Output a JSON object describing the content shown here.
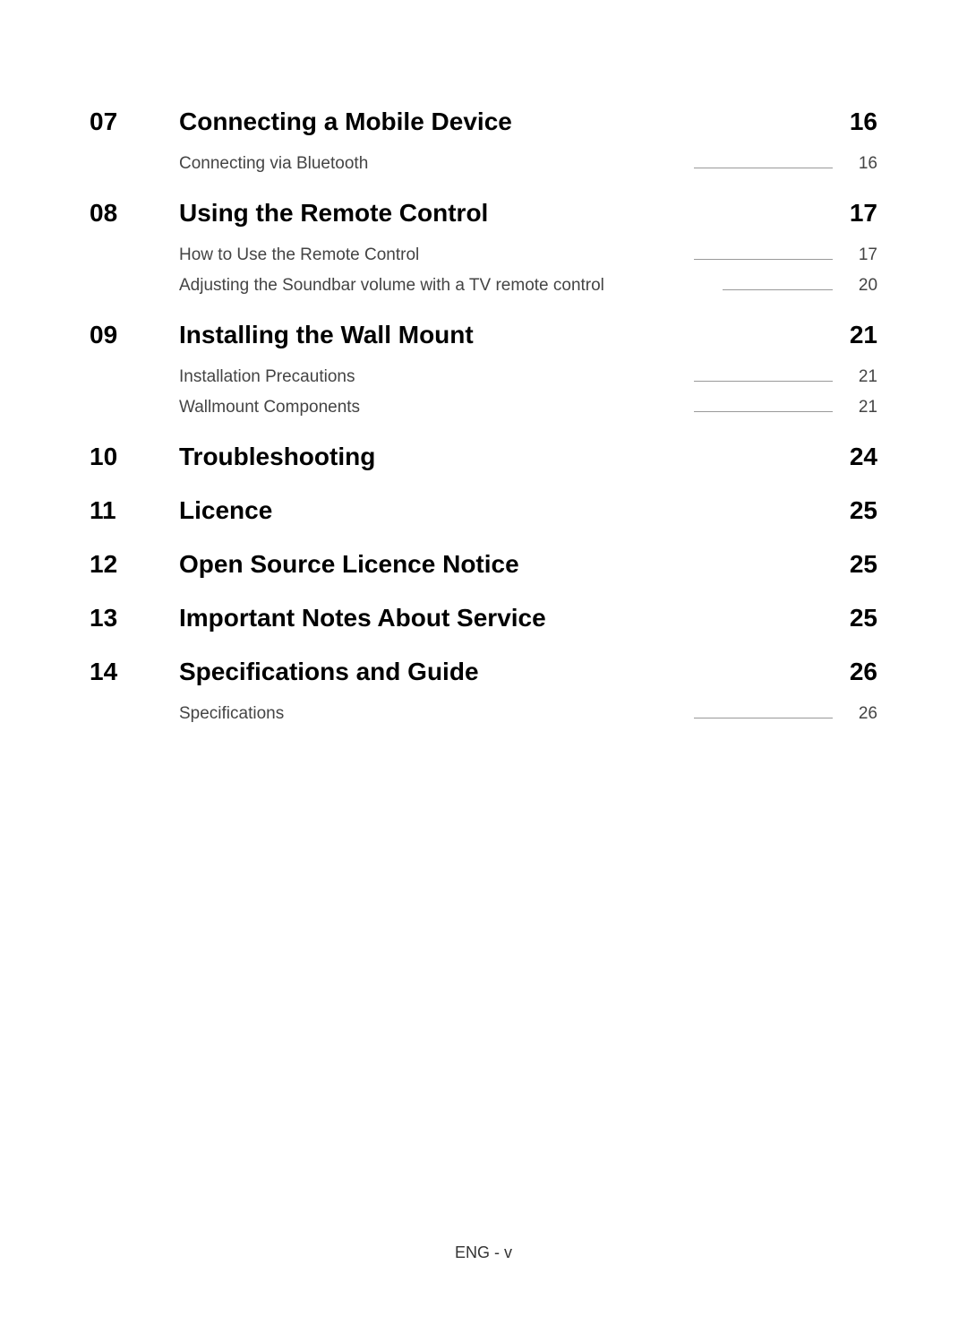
{
  "sections": [
    {
      "number": "07",
      "title": "Connecting a Mobile Device",
      "page": "16",
      "items": [
        {
          "title": "Connecting via Bluetooth",
          "page": "16"
        }
      ]
    },
    {
      "number": "08",
      "title": "Using the Remote Control",
      "page": "17",
      "items": [
        {
          "title": "How to Use the Remote Control",
          "page": "17"
        },
        {
          "title": "Adjusting the Soundbar volume with a TV remote control",
          "page": "20"
        }
      ]
    },
    {
      "number": "09",
      "title": "Installing the Wall Mount",
      "page": "21",
      "items": [
        {
          "title": "Installation Precautions",
          "page": "21"
        },
        {
          "title": "Wallmount Components",
          "page": "21"
        }
      ]
    },
    {
      "number": "10",
      "title": "Troubleshooting",
      "page": "24",
      "items": []
    },
    {
      "number": "11",
      "title": "Licence",
      "page": "25",
      "items": []
    },
    {
      "number": "12",
      "title": "Open Source Licence Notice",
      "page": "25",
      "items": []
    },
    {
      "number": "13",
      "title": "Important Notes About Service",
      "page": "25",
      "items": []
    },
    {
      "number": "14",
      "title": "Specifications and Guide",
      "page": "26",
      "items": [
        {
          "title": "Specifications",
          "page": "26"
        }
      ]
    }
  ],
  "footer": "ENG - v"
}
